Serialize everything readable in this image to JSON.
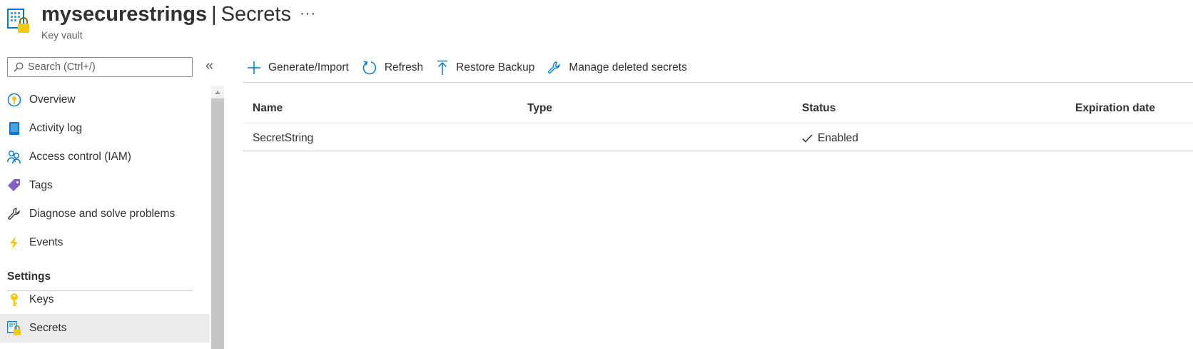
{
  "header": {
    "resource_name": "mysecurestrings",
    "separator": "|",
    "page_name": "Secrets",
    "subtitle": "Key vault",
    "more_label": "···",
    "icon": "key-vault-icon"
  },
  "search": {
    "placeholder": "Search (Ctrl+/)",
    "value": ""
  },
  "collapse_label": "«",
  "sidebar": {
    "items": [
      {
        "label": "Overview",
        "icon": "overview-icon"
      },
      {
        "label": "Activity log",
        "icon": "activity-log-icon"
      },
      {
        "label": "Access control (IAM)",
        "icon": "iam-icon"
      },
      {
        "label": "Tags",
        "icon": "tag-icon"
      },
      {
        "label": "Diagnose and solve problems",
        "icon": "wrench-icon"
      },
      {
        "label": "Events",
        "icon": "lightning-icon"
      }
    ],
    "settings_header": "Settings",
    "settings_items": [
      {
        "label": "Keys",
        "icon": "key-icon"
      },
      {
        "label": "Secrets",
        "icon": "secrets-icon",
        "active": true
      }
    ]
  },
  "toolbar": {
    "generate": "Generate/Import",
    "refresh": "Refresh",
    "restore": "Restore Backup",
    "manage_deleted": "Manage deleted secrets"
  },
  "table": {
    "columns": [
      "Name",
      "Type",
      "Status",
      "Expiration date"
    ],
    "rows": [
      {
        "name": "SecretString",
        "type": "",
        "status": "Enabled",
        "expiration": ""
      }
    ]
  },
  "colors": {
    "accent": "#0078d4",
    "key_gold": "#f2c811",
    "tag_purple": "#8661c5",
    "active_bg": "#ebebeb"
  }
}
